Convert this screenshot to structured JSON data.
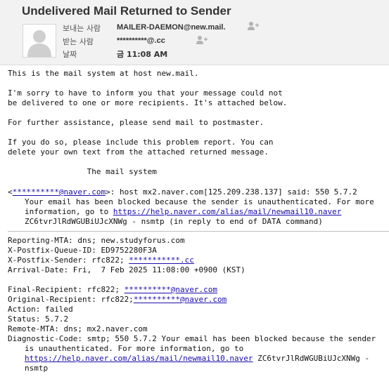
{
  "email": {
    "subject": "Undelivered Mail Returned to Sender",
    "from_label": "보내는 사람",
    "from_value": "MAILER-DAEMON@new.mail.",
    "to_label": "받는 사람",
    "to_value": "**********@.cc",
    "date_label": "날짜",
    "date_value": "금 11:08 AM"
  },
  "body": {
    "p1": "This is the mail system at host new.mail.",
    "p2a": "I'm sorry to have to inform you that your message could not",
    "p2b": "be delivered to one or more recipients. It's attached below.",
    "p3": "For further assistance, please send mail to postmaster.",
    "p4a": "If you do so, please include this problem report. You can",
    "p4b": "delete your own text from the attached returned message.",
    "sig": "                 The mail system",
    "bounce_lt": "<",
    "bounce_addr": "**********@naver.com",
    "bounce_rest": ">: host mx2.naver.com[125.209.238.137] said: 550 5.7.2",
    "bounce_l2": "Your email has been blocked because the sender is unauthenticated. For more",
    "bounce_l3a": "information, go to ",
    "bounce_link": "https://help.naver.com/alias/mail/newmail10.naver",
    "bounce_l4": "ZC6tvrJlRdWGUBiUJcXNWg - nsmtp (in reply to end of DATA command)"
  },
  "report": {
    "r1": "Reporting-MTA: dns; new.studyforus.com",
    "r2": "X-Postfix-Queue-ID: ED9752280F3A",
    "r3a": "X-Postfix-Sender: rfc822; ",
    "r3link": "***********.cc",
    "r4": "Arrival-Date: Fri,  7 Feb 2025 11:08:00 +0900 (KST)",
    "r5a": "Final-Recipient: rfc822; ",
    "r5link": "**********@naver.com",
    "r6a": "Original-Recipient: rfc822;",
    "r6link": "**********@naver.com",
    "r7": "Action: failed",
    "r8": "Status: 5.7.2",
    "r9": "Remote-MTA: dns; mx2.naver.com",
    "r10": "Diagnostic-Code: smtp; 550 5.7.2 Your email has been blocked because the sender",
    "r11": "is unauthenticated. For more information, go to",
    "r12link": "https://help.naver.com/alias/mail/newmail10.naver",
    "r12b": " ZC6tvrJlRdWGUBiUJcXNWg -",
    "r13": "nsmtp"
  }
}
